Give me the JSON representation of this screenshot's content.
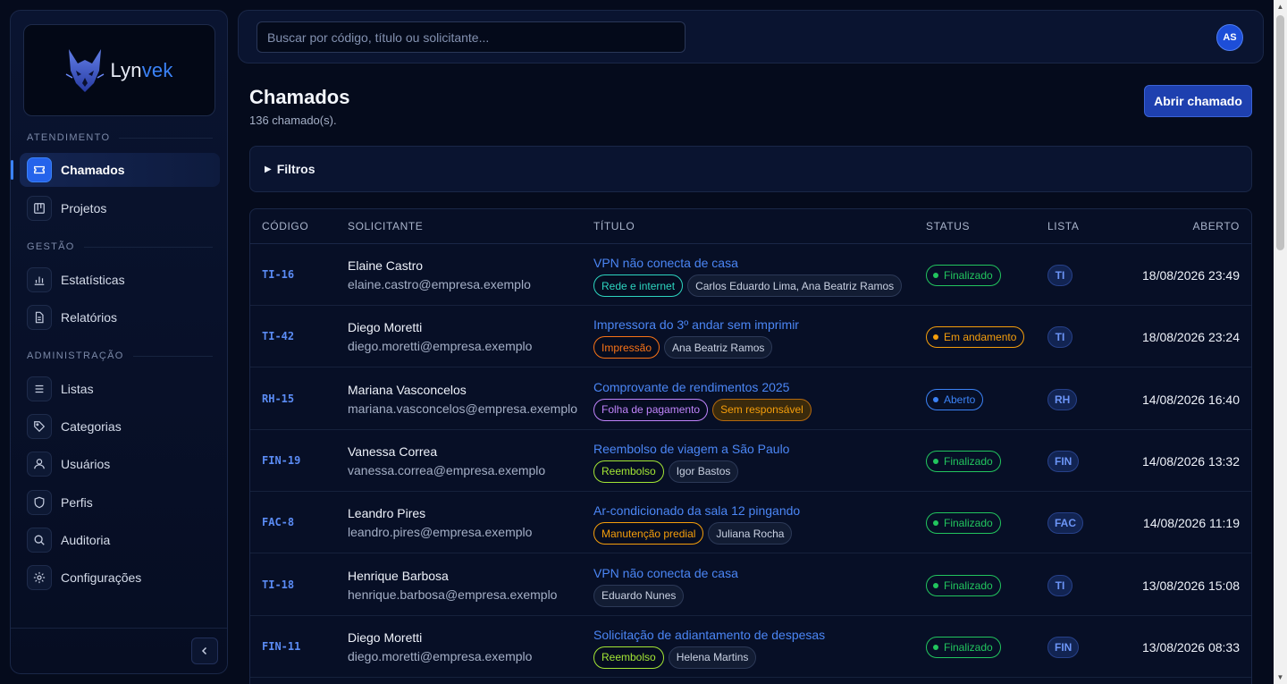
{
  "brand": {
    "name_a": "Lyn",
    "name_b": "vek"
  },
  "sidebar": {
    "sections": [
      {
        "label": "ATENDIMENTO"
      },
      {
        "label": "GESTÃO"
      },
      {
        "label": "ADMINISTRAÇÃO"
      }
    ],
    "items": [
      {
        "label": "Chamados",
        "icon": "ticket-icon",
        "active": true
      },
      {
        "label": "Projetos",
        "icon": "kanban-icon"
      },
      {
        "label": "Estatísticas",
        "icon": "bar-chart-icon"
      },
      {
        "label": "Relatórios",
        "icon": "document-icon"
      },
      {
        "label": "Listas",
        "icon": "list-icon"
      },
      {
        "label": "Categorias",
        "icon": "tag-icon"
      },
      {
        "label": "Usuários",
        "icon": "user-icon"
      },
      {
        "label": "Perfis",
        "icon": "shield-icon"
      },
      {
        "label": "Auditoria",
        "icon": "search-icon"
      },
      {
        "label": "Configurações",
        "icon": "gear-icon"
      }
    ]
  },
  "topbar": {
    "search_placeholder": "Buscar por código, título ou solicitante...",
    "avatar_initials": "AS"
  },
  "header": {
    "title": "Chamados",
    "count": "136 chamado(s).",
    "new_button": "Abrir chamado"
  },
  "filters": {
    "label": "Filtros"
  },
  "table": {
    "columns": {
      "code": "CÓDIGO",
      "requester": "SOLICITANTE",
      "title": "TÍTULO",
      "status": "STATUS",
      "list": "LISTA",
      "opened": "ABERTO"
    },
    "rows": [
      {
        "code": "TI-16",
        "name": "Elaine Castro",
        "email": "elaine.castro@empresa.exemplo",
        "title": "VPN não conecta de casa",
        "category": "Rede e internet",
        "category_color": "#2dd4bf",
        "assignee": "Carlos Eduardo Lima, Ana Beatriz Ramos",
        "assignee_warn": false,
        "status": "Finalizado",
        "status_color": "#22c55e",
        "list": "TI",
        "opened": "18/08/2026 23:49"
      },
      {
        "code": "TI-42",
        "name": "Diego Moretti",
        "email": "diego.moretti@empresa.exemplo",
        "title": "Impressora do 3º andar sem imprimir",
        "category": "Impressão",
        "category_color": "#f97316",
        "assignee": "Ana Beatriz Ramos",
        "assignee_warn": false,
        "status": "Em andamento",
        "status_color": "#f59e0b",
        "list": "TI",
        "opened": "18/08/2026 23:24"
      },
      {
        "code": "RH-15",
        "name": "Mariana Vasconcelos",
        "email": "mariana.vasconcelos@empresa.exemplo",
        "title": "Comprovante de rendimentos 2025",
        "category": "Folha de pagamento",
        "category_color": "#c084fc",
        "assignee": "Sem responsável",
        "assignee_warn": true,
        "status": "Aberto",
        "status_color": "#3b82f6",
        "list": "RH",
        "opened": "14/08/2026 16:40"
      },
      {
        "code": "FIN-19",
        "name": "Vanessa Correa",
        "email": "vanessa.correa@empresa.exemplo",
        "title": "Reembolso de viagem a São Paulo",
        "category": "Reembolso",
        "category_color": "#a3e635",
        "assignee": "Igor Bastos",
        "assignee_warn": false,
        "status": "Finalizado",
        "status_color": "#22c55e",
        "list": "FIN",
        "opened": "14/08/2026 13:32"
      },
      {
        "code": "FAC-8",
        "name": "Leandro Pires",
        "email": "leandro.pires@empresa.exemplo",
        "title": "Ar-condicionado da sala 12 pingando",
        "category": "Manutenção predial",
        "category_color": "#f59e0b",
        "assignee": "Juliana Rocha",
        "assignee_warn": false,
        "status": "Finalizado",
        "status_color": "#22c55e",
        "list": "FAC",
        "opened": "14/08/2026 11:19"
      },
      {
        "code": "TI-18",
        "name": "Henrique Barbosa",
        "email": "henrique.barbosa@empresa.exemplo",
        "title": "VPN não conecta de casa",
        "category": "",
        "category_color": "",
        "assignee": "Eduardo Nunes",
        "assignee_warn": false,
        "status": "Finalizado",
        "status_color": "#22c55e",
        "list": "TI",
        "opened": "13/08/2026 15:08"
      },
      {
        "code": "FIN-11",
        "name": "Diego Moretti",
        "email": "diego.moretti@empresa.exemplo",
        "title": "Solicitação de adiantamento de despesas",
        "category": "Reembolso",
        "category_color": "#a3e635",
        "assignee": "Helena Martins",
        "assignee_warn": false,
        "status": "Finalizado",
        "status_color": "#22c55e",
        "list": "FIN",
        "opened": "13/08/2026 08:33"
      }
    ]
  }
}
